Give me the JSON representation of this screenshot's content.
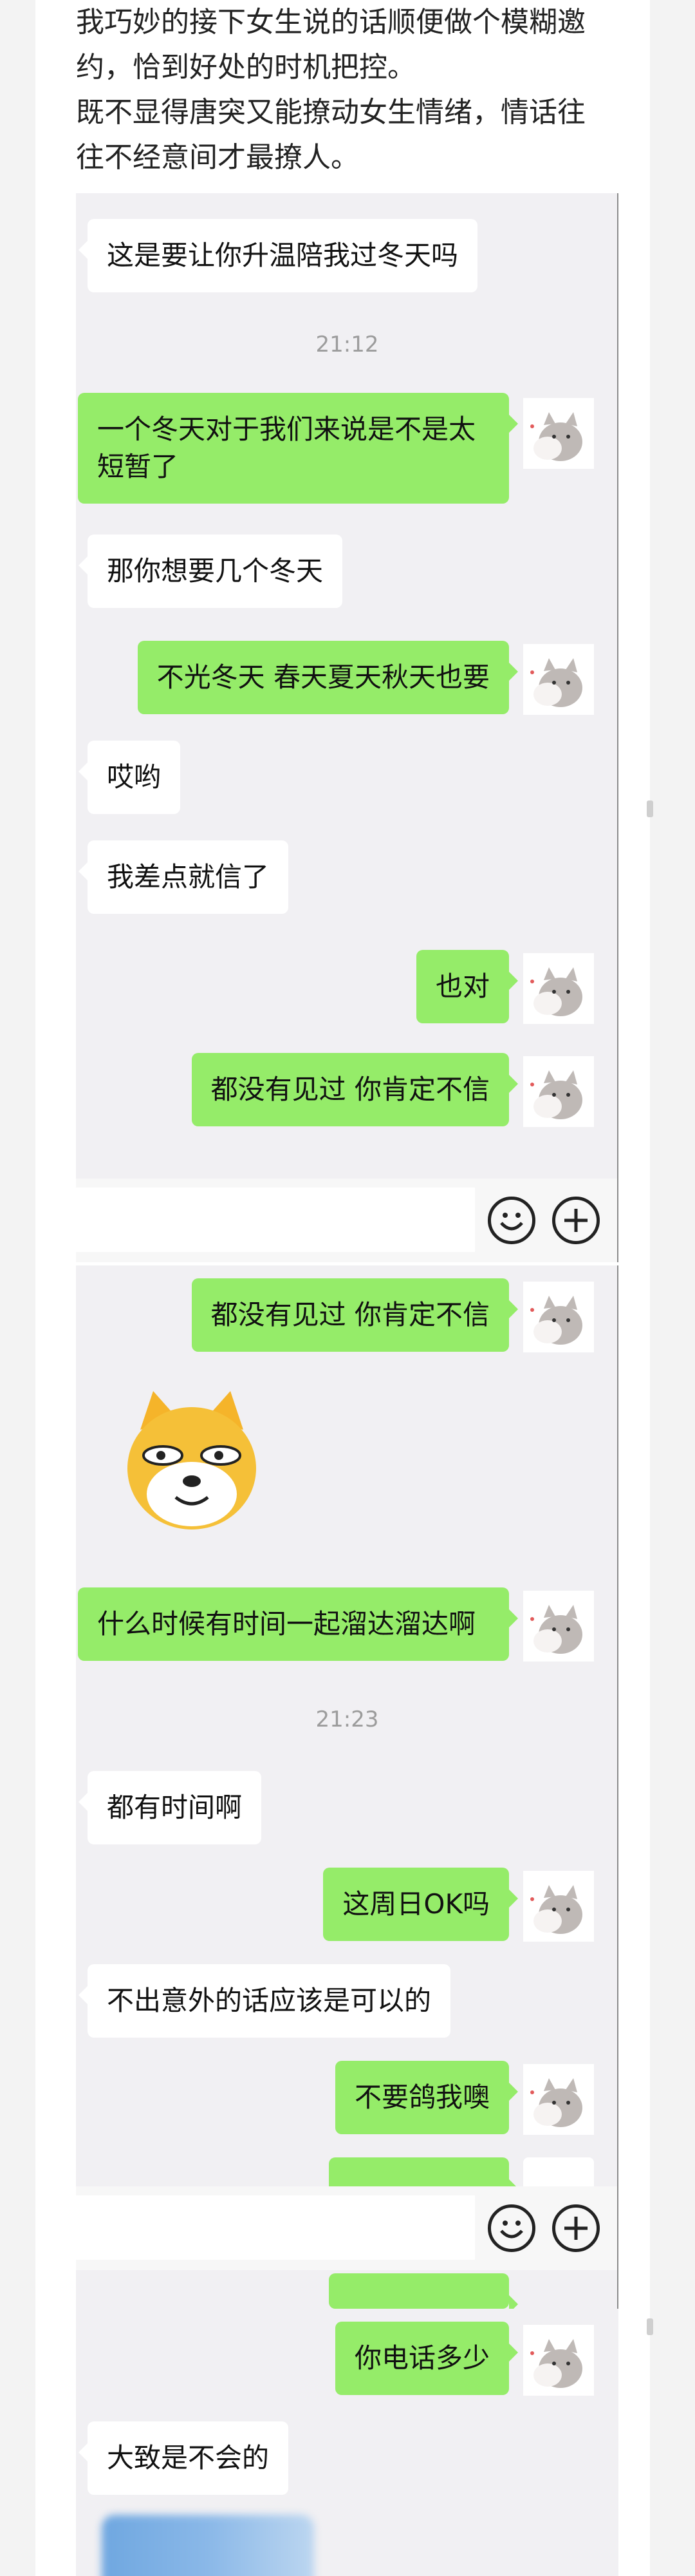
{
  "intro": {
    "line1": "我巧妙的接下女生说的话顺便做个模糊邀约，恰到好处的时机把控。",
    "line2": "既不显得唐突又能撩动女生情绪，情话往往不经意间才最撩人。"
  },
  "chat1": {
    "messages": [
      {
        "side": "left",
        "text": "这是要让你升温陪我过冬天吗"
      },
      {
        "side": "time",
        "text": "21:12"
      },
      {
        "side": "right",
        "text": "一个冬天对于我们来说是不是太短暂了"
      },
      {
        "side": "left",
        "text": "那你想要几个冬天"
      },
      {
        "side": "right",
        "text": "不光冬天 春天夏天秋天也要"
      },
      {
        "side": "left",
        "text": "哎哟"
      },
      {
        "side": "left",
        "text": "我差点就信了"
      },
      {
        "side": "right",
        "text": "也对"
      },
      {
        "side": "right",
        "text": "都没有见过 你肯定不信"
      }
    ]
  },
  "chat2": {
    "messages": [
      {
        "side": "right",
        "text": "都没有见过 你肯定不信"
      },
      {
        "side": "sticker",
        "text": ""
      },
      {
        "side": "right",
        "text": "什么时候有时间一起溜达溜达啊"
      },
      {
        "side": "time",
        "text": "21:23"
      },
      {
        "side": "left",
        "text": "都有时间啊"
      },
      {
        "side": "right",
        "text": "这周日OK吗"
      },
      {
        "side": "left",
        "text": "不出意外的话应该是可以的"
      },
      {
        "side": "right",
        "text": "不要鸽我噢"
      }
    ]
  },
  "chat3": {
    "messages": [
      {
        "side": "right",
        "text": "你电话多少"
      },
      {
        "side": "left",
        "text": "大致是不会的"
      }
    ]
  },
  "icons": {
    "emoji": "smiley-icon",
    "plus": "plus-circle-icon",
    "avatar": "cat-avatar",
    "sticker": "doge-sticker"
  },
  "colors": {
    "sent_bubble": "#95ec69",
    "received_bubble": "#ffffff",
    "chat_background": "#f1f0f3"
  }
}
